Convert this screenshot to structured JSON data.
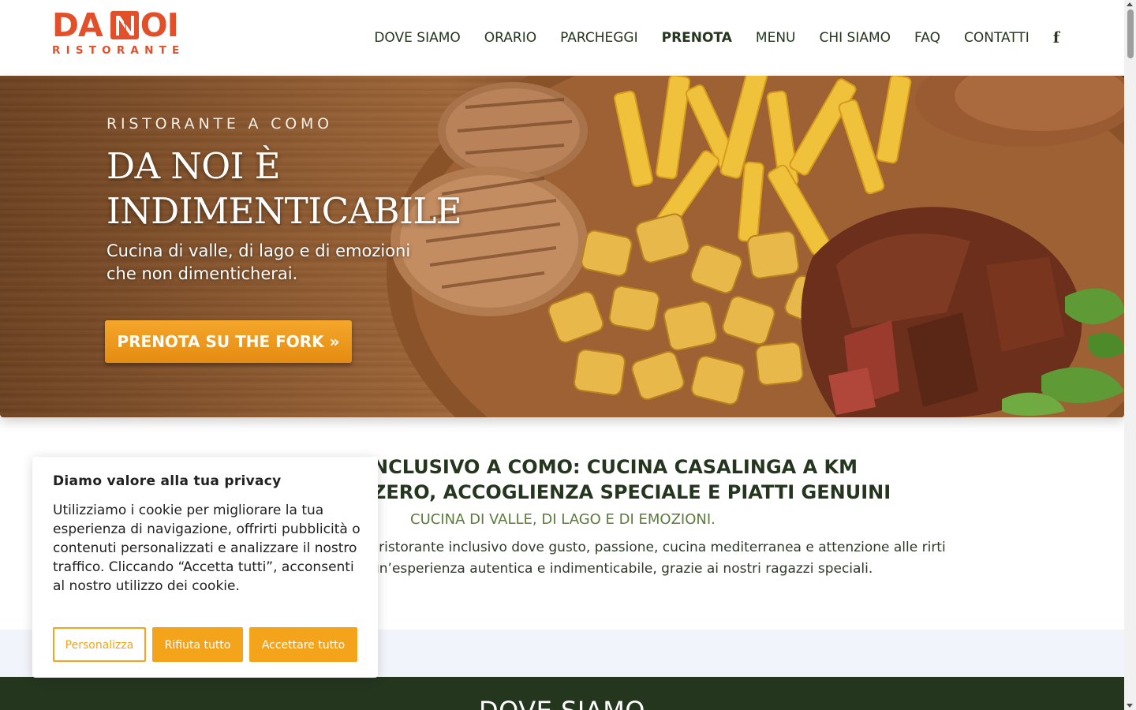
{
  "brand": {
    "logo_top_left": "DA",
    "logo_top_right": "OI",
    "logo_sub": "RISTORANTE",
    "color": "#e2502a"
  },
  "nav": {
    "items": [
      {
        "label": "DOVE SIAMO"
      },
      {
        "label": "ORARIO"
      },
      {
        "label": "PARCHEGGI"
      },
      {
        "label": "PRENOTA"
      },
      {
        "label": "MENU"
      },
      {
        "label": "CHI SIAMO"
      },
      {
        "label": "FAQ"
      },
      {
        "label": "CONTATTI"
      }
    ],
    "facebook_icon": "f"
  },
  "hero": {
    "kicker": "RISTORANTE A COMO",
    "title": "DA NOI È INDIMENTICABILE",
    "subtitle": "Cucina di valle, di lago e di emozioni che non dimenticherai.",
    "cta": "PRENOTA SU THE FORK »"
  },
  "intro": {
    "title": "NCLUSIVO A COMO: CUCINA CASALINGA A KM ZERO, ACCOGLIENZA SPECIALE E PIATTI GENUINI",
    "kicker": "CUCINA DI VALLE, DI LAGO E DI EMOZIONI.",
    "text": "l ristorante inclusivo dove gusto, passione, cucina mediterranea e attenzione alle rirti un’esperienza autentica e indimenticabile, grazie ai nostri ragazzi speciali."
  },
  "section_next": {
    "title": "DOVE SIAMO"
  },
  "cookie": {
    "title": "Diamo valore alla tua privacy",
    "text": "Utilizziamo i cookie per migliorare la tua esperienza di navigazione, offrirti pubblicità o contenuti personalizzati e analizzare il nostro traffico. Cliccando “Accetta tutti”, acconsenti al nostro utilizzo dei cookie.",
    "customize": "Personalizza",
    "reject": "Rifiuta tutto",
    "accept": "Accettare tutto",
    "accent": "#f3a41a"
  }
}
